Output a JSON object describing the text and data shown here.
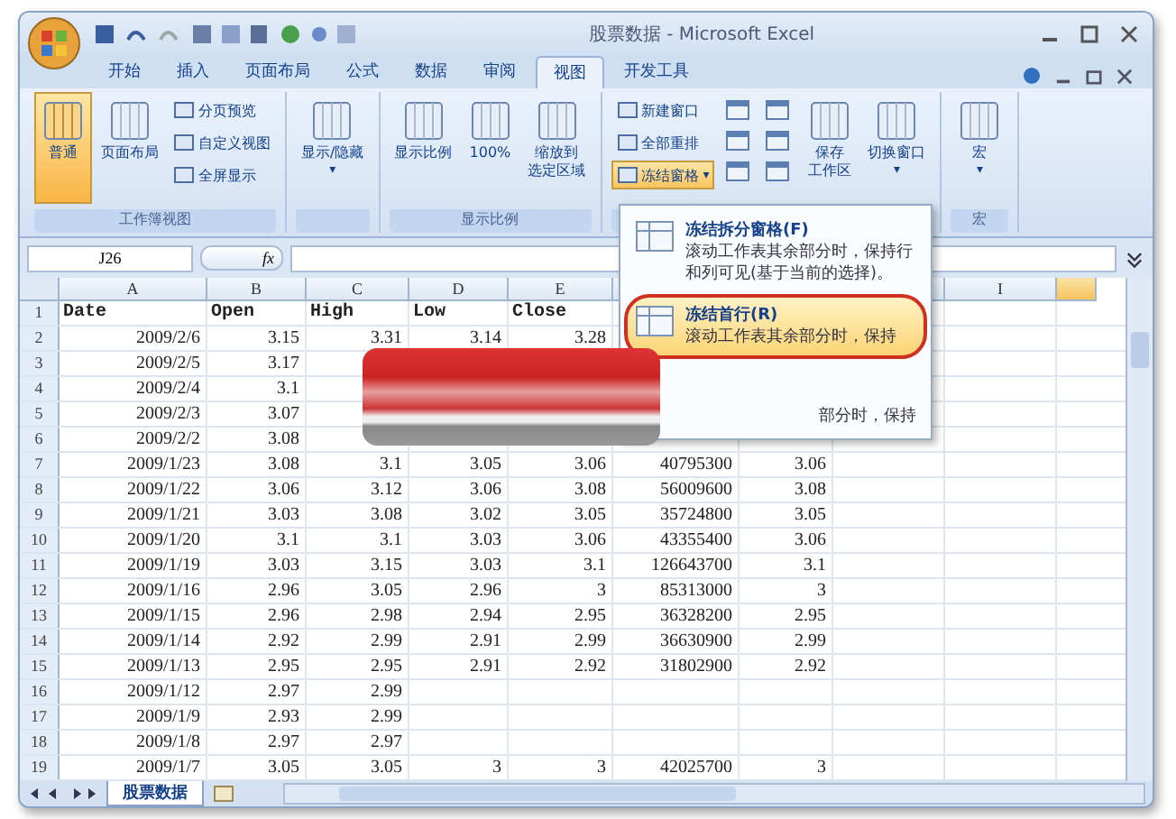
{
  "window": {
    "title": "股票数据 - Microsoft Excel"
  },
  "tabs": [
    {
      "label": "开始",
      "selected": false
    },
    {
      "label": "插入",
      "selected": false
    },
    {
      "label": "页面布局",
      "selected": false
    },
    {
      "label": "公式",
      "selected": false
    },
    {
      "label": "数据",
      "selected": false
    },
    {
      "label": "审阅",
      "selected": false
    },
    {
      "label": "视图",
      "selected": true
    },
    {
      "label": "开发工具",
      "selected": false
    }
  ],
  "ribbon_groups": [
    {
      "label": "工作簿视图",
      "items": [
        {
          "kind": "large",
          "lines": [
            "普通"
          ],
          "selected": true
        },
        {
          "kind": "large",
          "lines": [
            "页面布局"
          ],
          "selected": false
        },
        {
          "kind": "stack",
          "buttons": [
            {
              "label": "分页预览",
              "selected": false
            },
            {
              "label": "自定义视图",
              "selected": false
            },
            {
              "label": "全屏显示",
              "selected": false
            }
          ]
        }
      ]
    },
    {
      "items": [
        {
          "kind": "large",
          "lines": [
            "显示/隐藏"
          ],
          "selected": false,
          "caret": "▾"
        }
      ]
    },
    {
      "label": "显示比例",
      "items": [
        {
          "kind": "large",
          "lines": [
            "显示比例"
          ],
          "selected": false
        },
        {
          "kind": "large",
          "lines": [
            "100%"
          ],
          "selected": false
        },
        {
          "kind": "large",
          "lines": [
            "缩放到",
            "选定区域"
          ],
          "selected": false
        }
      ]
    },
    {
      "items": [
        {
          "kind": "stack",
          "buttons": [
            {
              "label": "新建窗口",
              "selected": false
            },
            {
              "label": "全部重排",
              "selected": false
            },
            {
              "label": "冻结窗格",
              "selected": true,
              "caret": "▾"
            }
          ]
        },
        {
          "kind": "icons"
        },
        {
          "kind": "large",
          "lines": [
            "保存",
            "工作区"
          ],
          "selected": false
        },
        {
          "kind": "large",
          "lines": [
            "切换窗口"
          ],
          "selected": false,
          "caret": "▾"
        }
      ]
    },
    {
      "label": "宏",
      "items": [
        {
          "kind": "large",
          "lines": [
            "宏"
          ],
          "selected": false,
          "caret": "▾"
        }
      ]
    }
  ],
  "formula_bar": {
    "name_box": "J26",
    "fx": "fx"
  },
  "columns": [
    "A",
    "B",
    "C",
    "D",
    "E",
    null,
    null,
    null,
    "I"
  ],
  "rows": [
    {
      "n": "1",
      "cells": [
        "Date",
        "Open",
        "High",
        "Low",
        "Close",
        null,
        null
      ]
    },
    {
      "n": "2",
      "cells": [
        "2009/2/6",
        "3.15",
        "3.31",
        "3.14",
        "3.28",
        null,
        null
      ]
    },
    {
      "n": "3",
      "cells": [
        "2009/2/5",
        "3.17",
        null,
        null,
        null,
        null,
        null
      ]
    },
    {
      "n": "4",
      "cells": [
        "2009/2/4",
        "3.1",
        null,
        null,
        null,
        null,
        null
      ]
    },
    {
      "n": "5",
      "cells": [
        "2009/2/3",
        "3.07",
        null,
        null,
        null,
        null,
        null
      ]
    },
    {
      "n": "6",
      "cells": [
        "2009/2/2",
        "3.08",
        null,
        null,
        null,
        null,
        null
      ]
    },
    {
      "n": "7",
      "cells": [
        "2009/1/23",
        "3.08",
        "3.1",
        "3.05",
        "3.06",
        "40795300",
        "3.06"
      ]
    },
    {
      "n": "8",
      "cells": [
        "2009/1/22",
        "3.06",
        "3.12",
        "3.06",
        "3.08",
        "56009600",
        "3.08"
      ]
    },
    {
      "n": "9",
      "cells": [
        "2009/1/21",
        "3.03",
        "3.08",
        "3.02",
        "3.05",
        "35724800",
        "3.05"
      ]
    },
    {
      "n": "10",
      "cells": [
        "2009/1/20",
        "3.1",
        "3.1",
        "3.03",
        "3.06",
        "43355400",
        "3.06"
      ]
    },
    {
      "n": "11",
      "cells": [
        "2009/1/19",
        "3.03",
        "3.15",
        "3.03",
        "3.1",
        "126643700",
        "3.1"
      ]
    },
    {
      "n": "12",
      "cells": [
        "2009/1/16",
        "2.96",
        "3.05",
        "2.96",
        "3",
        "85313000",
        "3"
      ]
    },
    {
      "n": "13",
      "cells": [
        "2009/1/15",
        "2.96",
        "2.98",
        "2.94",
        "2.95",
        "36328200",
        "2.95"
      ]
    },
    {
      "n": "14",
      "cells": [
        "2009/1/14",
        "2.92",
        "2.99",
        "2.91",
        "2.99",
        "36630900",
        "2.99"
      ]
    },
    {
      "n": "15",
      "cells": [
        "2009/1/13",
        "2.95",
        "2.95",
        "2.91",
        "2.92",
        "31802900",
        "2.92"
      ]
    },
    {
      "n": "16",
      "cells": [
        "2009/1/12",
        "2.97",
        "2.99",
        null,
        null,
        null,
        null
      ]
    },
    {
      "n": "17",
      "cells": [
        "2009/1/9",
        "2.93",
        "2.99",
        null,
        null,
        null,
        null
      ]
    },
    {
      "n": "18",
      "cells": [
        "2009/1/8",
        "2.97",
        "2.97",
        null,
        null,
        null,
        null
      ]
    },
    {
      "n": "19",
      "cells": [
        "2009/1/7",
        "3.05",
        "3.05",
        "3",
        "3",
        "42025700",
        "3"
      ]
    }
  ],
  "menu": [
    {
      "title": "冻结拆分窗格(F)",
      "description": "滚动工作表其余部分时，保持行和列可见(基于当前的选择)。",
      "highlighted": false
    },
    {
      "title": "冻结首行(R)",
      "description": "滚动工作表其余部分时，保持",
      "highlighted": true
    },
    {
      "description": "部分时，保持",
      "highlighted": false
    }
  ],
  "sheet_tabs": [
    {
      "label": "股票数据",
      "selected": true
    }
  ]
}
